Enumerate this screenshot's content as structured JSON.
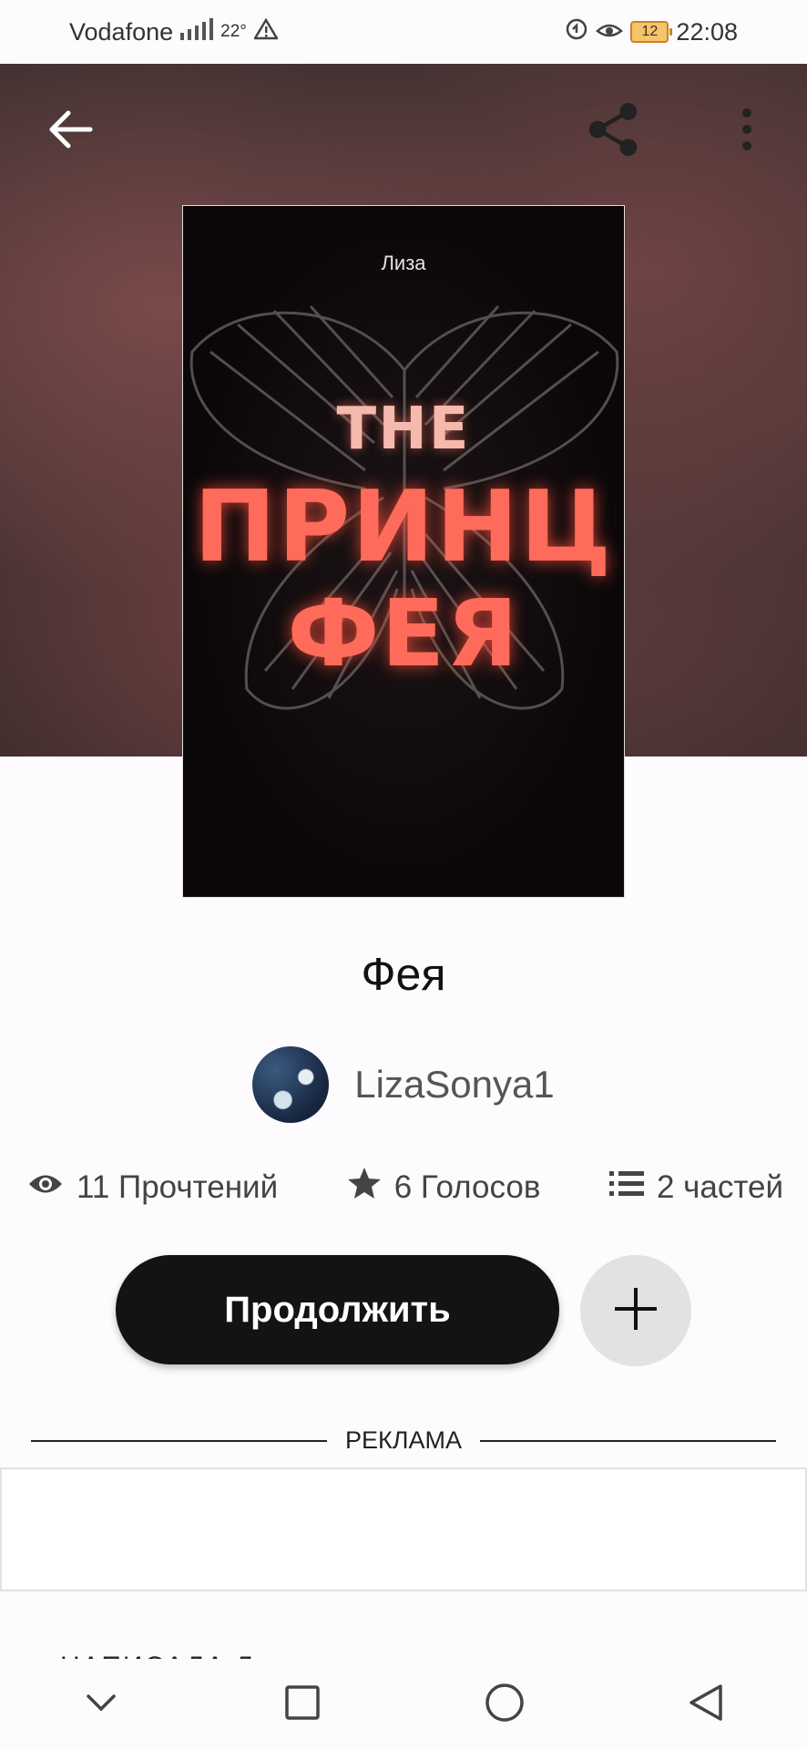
{
  "status_bar": {
    "carrier": "Vodafone",
    "temperature": "22°",
    "battery": "12",
    "time": "22:08"
  },
  "book": {
    "cover": {
      "author": "Лиза",
      "line_1": "THE",
      "line_2": "ПРИНЦ",
      "line_3": "ФЕЯ"
    },
    "title": "Фея",
    "author_name": "LizaSonya1",
    "stats": {
      "reads": "11 Прочтений",
      "votes": "6 Голосов",
      "parts": "2 частей"
    },
    "continue_label": "Продолжить"
  },
  "ad": {
    "label": "РЕКЛАМА"
  },
  "written_by_label": "НАПИСАЛА Л",
  "colors": {
    "accent": "#141214",
    "cover_text": "#ff6b5a",
    "add_button_bg": "#e4e1e4"
  },
  "icons": [
    "back-arrow-icon",
    "share-icon",
    "more-vertical-icon",
    "eye-icon",
    "star-icon",
    "list-icon",
    "plus-icon"
  ]
}
